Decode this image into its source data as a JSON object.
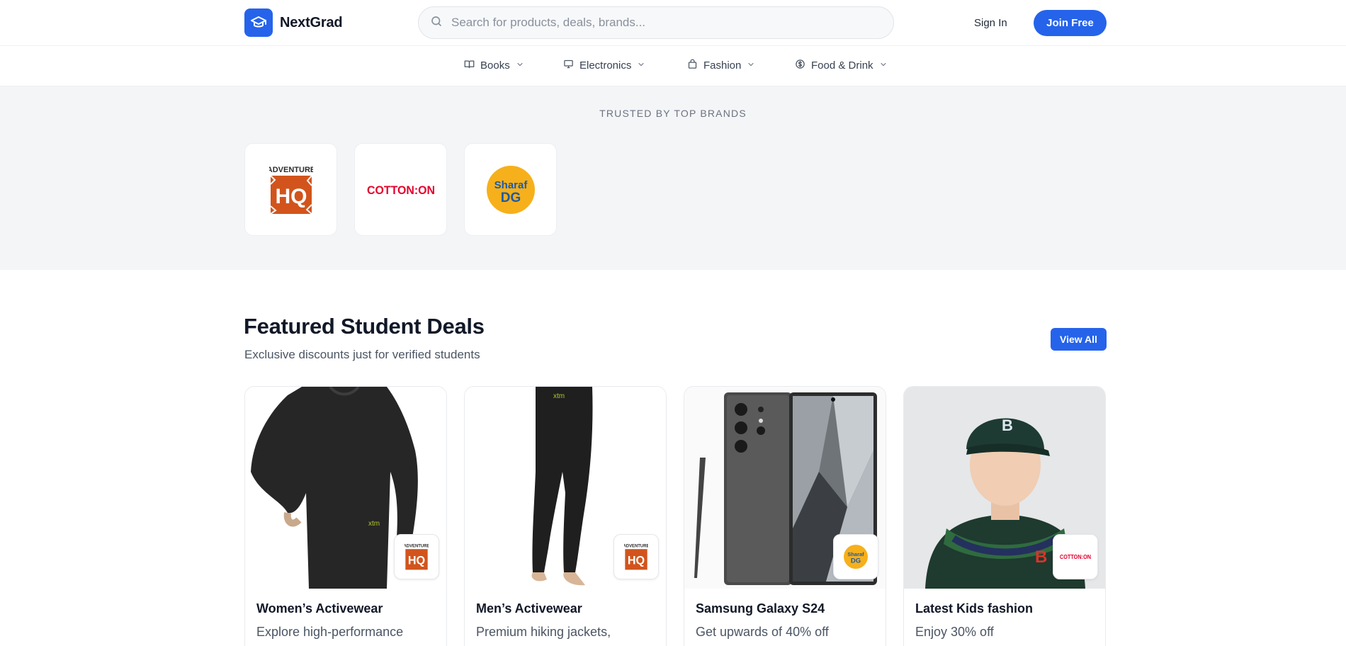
{
  "brand": {
    "name": "NextGrad",
    "logo_icon": "graduation-cap-icon"
  },
  "search": {
    "placeholder": "Search for products, deals, brands..."
  },
  "auth": {
    "sign_in": "Sign In",
    "join": "Join Free"
  },
  "categories": [
    {
      "label": "Books",
      "icon": "book-icon"
    },
    {
      "label": "Electronics",
      "icon": "monitor-icon"
    },
    {
      "label": "Fashion",
      "icon": "shopping-bag-icon"
    },
    {
      "label": "Food & Drink",
      "icon": "dollar-circle-icon"
    }
  ],
  "trusted": {
    "title": "TRUSTED BY TOP BRANDS",
    "brands": [
      {
        "name": "Adventure HQ",
        "logo_lines": [
          "ADVENTURE",
          "HQ"
        ]
      },
      {
        "name": "Cotton On",
        "logo_text": "COTTON:ON"
      },
      {
        "name": "Sharaf DG",
        "logo_lines": [
          "Sharaf",
          "DG"
        ]
      }
    ]
  },
  "featured": {
    "title": "Featured Student Deals",
    "subtitle": "Exclusive discounts just for verified students",
    "view_all": "View All",
    "deals": [
      {
        "title": "Women’s Activewear",
        "description": "Explore high-performance",
        "brand": "Adventure HQ"
      },
      {
        "title": "Men’s Activewear",
        "description": "Premium hiking jackets,",
        "brand": "Adventure HQ"
      },
      {
        "title": "Samsung Galaxy S24",
        "description": "Get upwards of 40% off",
        "brand": "Sharaf DG"
      },
      {
        "title": "Latest Kids fashion",
        "description": "Enjoy 30% off",
        "brand": "Cotton On"
      }
    ]
  },
  "colors": {
    "accent": "#2563eb",
    "brand_orange": "#d2541c",
    "cotton_red": "#e4002b",
    "sharaf_yellow": "#f6b01b",
    "sharaf_blue": "#1d5aa8"
  }
}
